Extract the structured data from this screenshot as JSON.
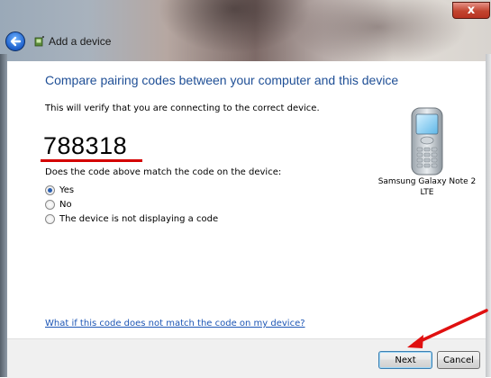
{
  "window": {
    "title": "Add a device",
    "close_label": "x"
  },
  "page": {
    "heading": "Compare pairing codes between your computer and this device",
    "description": "This will verify that you are connecting to the correct device.",
    "pairing_code": "788318",
    "question": "Does the code above match the code on the device:",
    "options": [
      {
        "label": "Yes",
        "checked": true
      },
      {
        "label": "No",
        "checked": false
      },
      {
        "label": "The device is not displaying a code",
        "checked": false
      }
    ],
    "device": {
      "name_line1": "Samsung Galaxy Note 2",
      "name_line2": "LTE",
      "icon": "mobile-phone-icon"
    },
    "help_link": "What if this code does not match the code on my device?"
  },
  "footer": {
    "next_label": "Next",
    "cancel_label": "Cancel"
  },
  "colors": {
    "heading": "#1f4f96",
    "annotation": "#d40000",
    "link": "#1d56b5"
  }
}
